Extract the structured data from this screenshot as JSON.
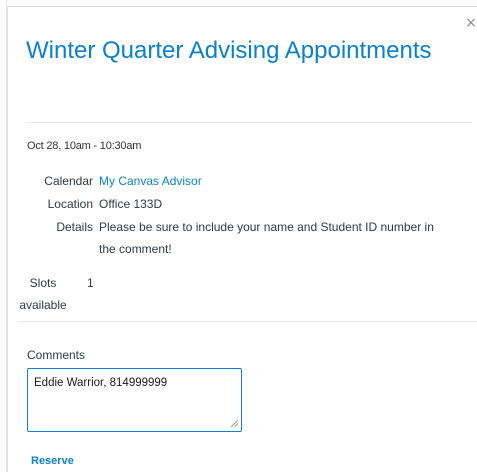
{
  "popover": {
    "title": "Winter Quarter Advising Appointments",
    "close_label": "×",
    "datetime": "Oct 28, 10am - 10:30am",
    "calendar": {
      "label": "Calendar",
      "value": "My Canvas Advisor"
    },
    "location": {
      "label": "Location",
      "value": "Office 133D"
    },
    "details": {
      "label": "Details",
      "value": "Please be sure to include your name and Student ID number in the comment!"
    },
    "slots": {
      "label": "Slots available",
      "value": "1"
    },
    "comments": {
      "label": "Comments",
      "value": "Eddie Warrior, 814999999"
    },
    "reserve_label": "Reserve"
  },
  "colors": {
    "accent": "#0e80c9",
    "text": "#2d3b45",
    "divider": "#e6e6e6"
  },
  "icons": {
    "close": "close-icon",
    "resize": "resize-grip-icon"
  }
}
